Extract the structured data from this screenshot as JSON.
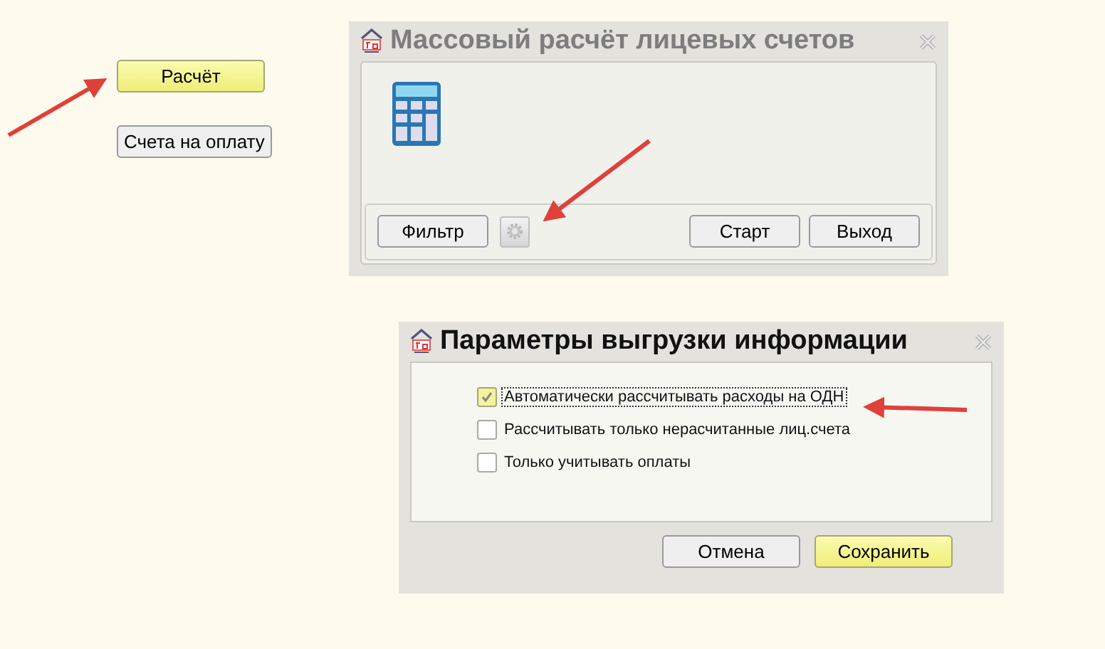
{
  "side_buttons": [
    {
      "label": "Расчёт",
      "highlighted": true
    },
    {
      "label": "Счета на оплату",
      "highlighted": false
    }
  ],
  "calc_window": {
    "title": "Массовый расчёт лицевых счетов",
    "active": false,
    "filter_button": "Фильтр",
    "buttons": [
      {
        "label": "Старт",
        "highlighted": false
      },
      {
        "label": "Выход",
        "highlighted": false
      }
    ]
  },
  "params_window": {
    "title": "Параметры выгрузки информации",
    "active": true,
    "options": [
      {
        "label": "Автоматически рассчитывать расходы на ОДН",
        "checked": true,
        "focused": true
      },
      {
        "label": "Рассчитывать только нерасчитанные лиц.счета",
        "checked": false,
        "focused": false
      },
      {
        "label": "Только учитывать оплаты",
        "checked": false,
        "focused": false
      }
    ],
    "buttons": [
      {
        "label": "Отмена",
        "highlighted": false
      },
      {
        "label": "Сохранить",
        "highlighted": true
      }
    ]
  }
}
